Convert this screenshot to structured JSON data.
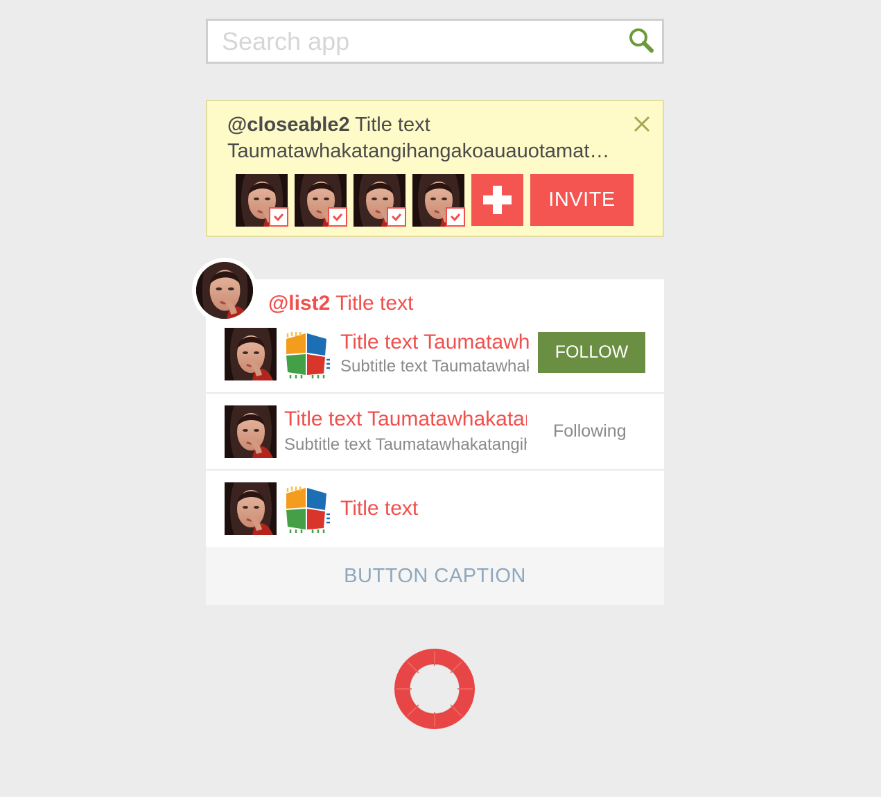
{
  "search": {
    "placeholder": "Search app",
    "value": "",
    "icon": "search-icon"
  },
  "closeable": {
    "handle": "@closeable2",
    "title": "Title text",
    "body": "Taumatawhakatangihangakoauauotamateaturipukakapikimaungahoronukupokaiwhenuakitanatahu",
    "invitee_count": 4,
    "plus_icon": "plus-icon",
    "invite_label": "INVITE",
    "close_icon": "close-icon"
  },
  "list": {
    "handle": "@list2",
    "title": "Title text",
    "rows": [
      {
        "title": "Title text Taumatawhakatangihangakoauauotamatea",
        "subtitle": "Subtitle text Taumatawhakatangihangakoauauotamatea",
        "action": "FOLLOW"
      },
      {
        "title": "Title text Taumatawhakatangihangakoauauotamatea",
        "subtitle": "Subtitle text Taumatawhakatangihangakoauauotamatea",
        "action": "Following"
      },
      {
        "title": "Title text"
      }
    ],
    "footer_button": "BUTTON CAPTION"
  },
  "colors": {
    "accent_red": "#f45550",
    "follow_green": "#6a8f42",
    "search_icon_green": "#6a9a3a",
    "notice_yellow": "#fffbc8",
    "footer_text_blue": "#8fa7bd",
    "background": "#ececec"
  }
}
